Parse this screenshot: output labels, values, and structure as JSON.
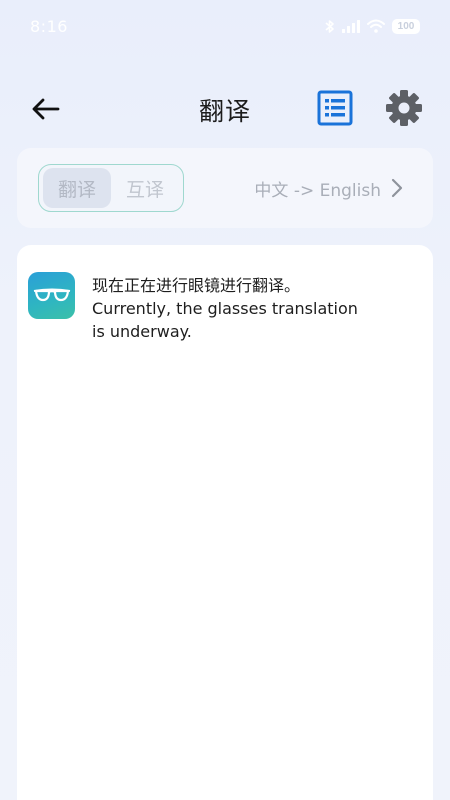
{
  "status_bar": {
    "time": "8:16",
    "battery": "100",
    "icons": [
      "bluetooth-icon",
      "signal-icon",
      "wifi-icon",
      "battery-icon"
    ]
  },
  "header": {
    "title": "翻译",
    "back_icon": "arrow-left-icon",
    "list_icon": "list-icon",
    "settings_icon": "gear-icon"
  },
  "mode_bar": {
    "tabs": [
      {
        "label": "翻译",
        "active": true
      },
      {
        "label": "互译",
        "active": false
      }
    ],
    "language_pair": "中文 -> English",
    "chevron_icon": "chevron-right-icon"
  },
  "messages": [
    {
      "avatar_icon": "glasses-icon",
      "original": "现在正在进行眼镜进行翻译。",
      "translation_line1": "Currently, the glasses translation",
      "translation_line2": "is underway."
    }
  ],
  "colors": {
    "accent_blue": "#1a73d9",
    "segment_border": "#9fd8cf",
    "background": "#eef2fb"
  }
}
